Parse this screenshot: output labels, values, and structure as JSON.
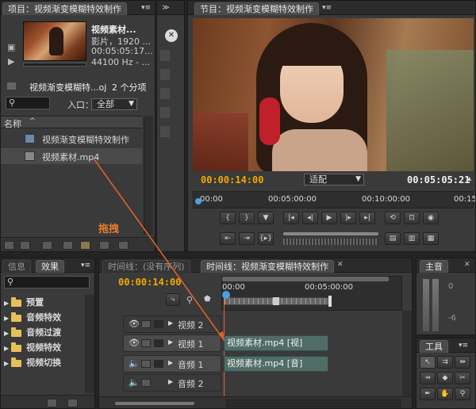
{
  "project": {
    "tab_label": "项目：视频渐变模糊特效制作",
    "clip_name": "视频素材...",
    "clip_type": "影片，1920 ...",
    "clip_duration": "00:05:05:17...",
    "clip_audio": "44100 Hz - ...",
    "project_file": "视频渐变模糊特...oj",
    "item_count": "2 个分项",
    "entry_label": "入口：",
    "entry_value": "全部",
    "name_header": "名称",
    "items": [
      {
        "label": "视频渐变模糊特效制作",
        "icon": "sequence-icon"
      },
      {
        "label": "视频素材.mp4",
        "icon": "video-file-icon"
      }
    ]
  },
  "program": {
    "tab_label": "节目：视频渐变模糊特效制作",
    "current_time": "00:00:14:00",
    "fit_label": "适配",
    "duration": "00:05:05:21",
    "ruler_labels": [
      "00:00",
      "00:05:00:00",
      "00:10:00:00",
      "00:15"
    ]
  },
  "annotation": {
    "drag_label": "拖拽"
  },
  "effects": {
    "tab_info": "信息",
    "tab_effects": "效果",
    "folders": [
      "预置",
      "音频特效",
      "音频过渡",
      "视频特效",
      "视频切换"
    ]
  },
  "timeline": {
    "tab_empty": "时间线：(没有序列)",
    "tab_active": "时间线：视频渐变模糊特效制作",
    "current_time": "00:00:14:00",
    "ruler_labels": [
      "00:00",
      "00:05:00:00"
    ],
    "tracks": [
      {
        "label": "视频 2",
        "clip": ""
      },
      {
        "label": "视频 1",
        "clip": "视频素材.mp4 [视]"
      },
      {
        "label": "音频 1",
        "clip": "视频素材.mp4 [音]"
      },
      {
        "label": "音频 2",
        "clip": ""
      }
    ]
  },
  "audio_master": {
    "tab_label": "主音",
    "level_0": "0",
    "level_6": "-6"
  },
  "tools": {
    "tab_label": "工具"
  },
  "colors": {
    "accent": "#f2a900",
    "clip": "#4f6d66",
    "drag_line": "#e8632a"
  }
}
